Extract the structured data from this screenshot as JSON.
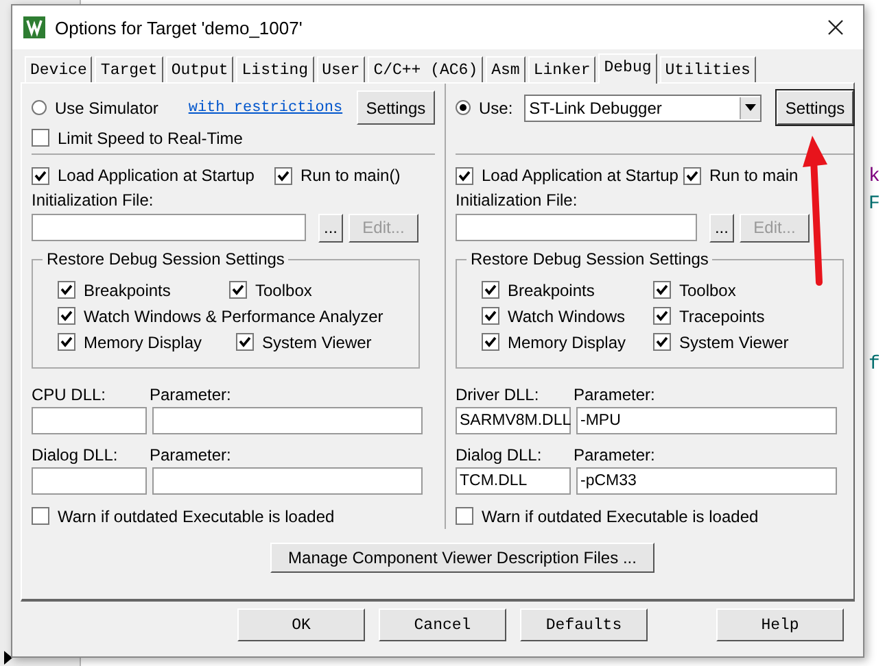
{
  "editor": {
    "right_fragments": [
      "k",
      "F",
      "f"
    ]
  },
  "window": {
    "title": "Options for Target 'demo_1007'"
  },
  "tabs": [
    {
      "label": "Device",
      "selected": false
    },
    {
      "label": "Target",
      "selected": false
    },
    {
      "label": "Output",
      "selected": false
    },
    {
      "label": "Listing",
      "selected": false
    },
    {
      "label": "User",
      "selected": false
    },
    {
      "label": "C/C++ (AC6)",
      "selected": false
    },
    {
      "label": "Asm",
      "selected": false
    },
    {
      "label": "Linker",
      "selected": false
    },
    {
      "label": "Debug",
      "selected": true
    },
    {
      "label": "Utilities",
      "selected": false
    }
  ],
  "panes": [
    {
      "kind": "simulator",
      "mode": {
        "label": "Use Simulator",
        "selected": false
      },
      "link": "with restrictions",
      "settings": "Settings",
      "limit_speed": {
        "label": "Limit Speed to Real-Time",
        "checked": false
      },
      "load_app": {
        "label": "Load Application at Startup",
        "checked": true
      },
      "run_to_main": {
        "label": "Run to main()",
        "checked": true
      },
      "init_label": "Initialization File:",
      "browse": "...",
      "edit": {
        "label": "Edit...",
        "disabled": true
      },
      "restore": {
        "title": "Restore Debug Session Settings",
        "items": [
          {
            "label": "Breakpoints",
            "checked": true,
            "kind": "half"
          },
          {
            "label": "Toolbox",
            "checked": true,
            "kind": "half"
          },
          {
            "label": "Watch Windows & Performance Analyzer",
            "checked": true,
            "kind": "wide"
          },
          {
            "label": "Memory Display",
            "checked": true,
            "kind": "half"
          },
          {
            "label": "System Viewer",
            "checked": true,
            "kind": "half"
          }
        ]
      },
      "dlls": [
        {
          "label": "CPU DLL:",
          "param_label": "Parameter:"
        },
        {
          "label": "Dialog DLL:",
          "param_label": "Parameter:"
        }
      ],
      "warn": {
        "label": "Warn if outdated Executable is loaded",
        "checked": false
      }
    },
    {
      "kind": "target",
      "mode": {
        "label": "Use:",
        "selected": true
      },
      "driver": "ST-Link Debugger",
      "settings": "Settings",
      "load_app": {
        "label": "Load Application at Startup",
        "checked": true
      },
      "run_to_main": {
        "label": "Run to main",
        "checked": true
      },
      "init_label": "Initialization File:",
      "browse": "...",
      "edit": {
        "label": "Edit...",
        "disabled": true
      },
      "restore": {
        "title": "Restore Debug Session Settings",
        "items": [
          {
            "label": "Breakpoints",
            "checked": true,
            "kind": "half"
          },
          {
            "label": "Toolbox",
            "checked": true,
            "kind": "half"
          },
          {
            "label": "Watch Windows",
            "checked": true,
            "kind": "half"
          },
          {
            "label": "Tracepoints",
            "checked": true,
            "kind": "half"
          },
          {
            "label": "Memory Display",
            "checked": true,
            "kind": "half"
          },
          {
            "label": "System Viewer",
            "checked": true,
            "kind": "half"
          }
        ]
      },
      "dlls": [
        {
          "label": "Driver DLL:",
          "value": "SARMV8M.DLL",
          "param_label": "Parameter:",
          "param_value": "-MPU"
        },
        {
          "label": "Dialog DLL:",
          "value": "TCM.DLL",
          "param_label": "Parameter:",
          "param_value": "-pCM33"
        }
      ],
      "warn": {
        "label": "Warn if outdated Executable is loaded",
        "checked": false
      }
    }
  ],
  "manage_button": "Manage Component Viewer Description Files ...",
  "buttons": [
    {
      "label": "OK",
      "kind": "left"
    },
    {
      "label": "Cancel",
      "kind": "left"
    },
    {
      "label": "Defaults",
      "kind": "left"
    },
    {
      "label": "Help",
      "kind": "right"
    }
  ]
}
